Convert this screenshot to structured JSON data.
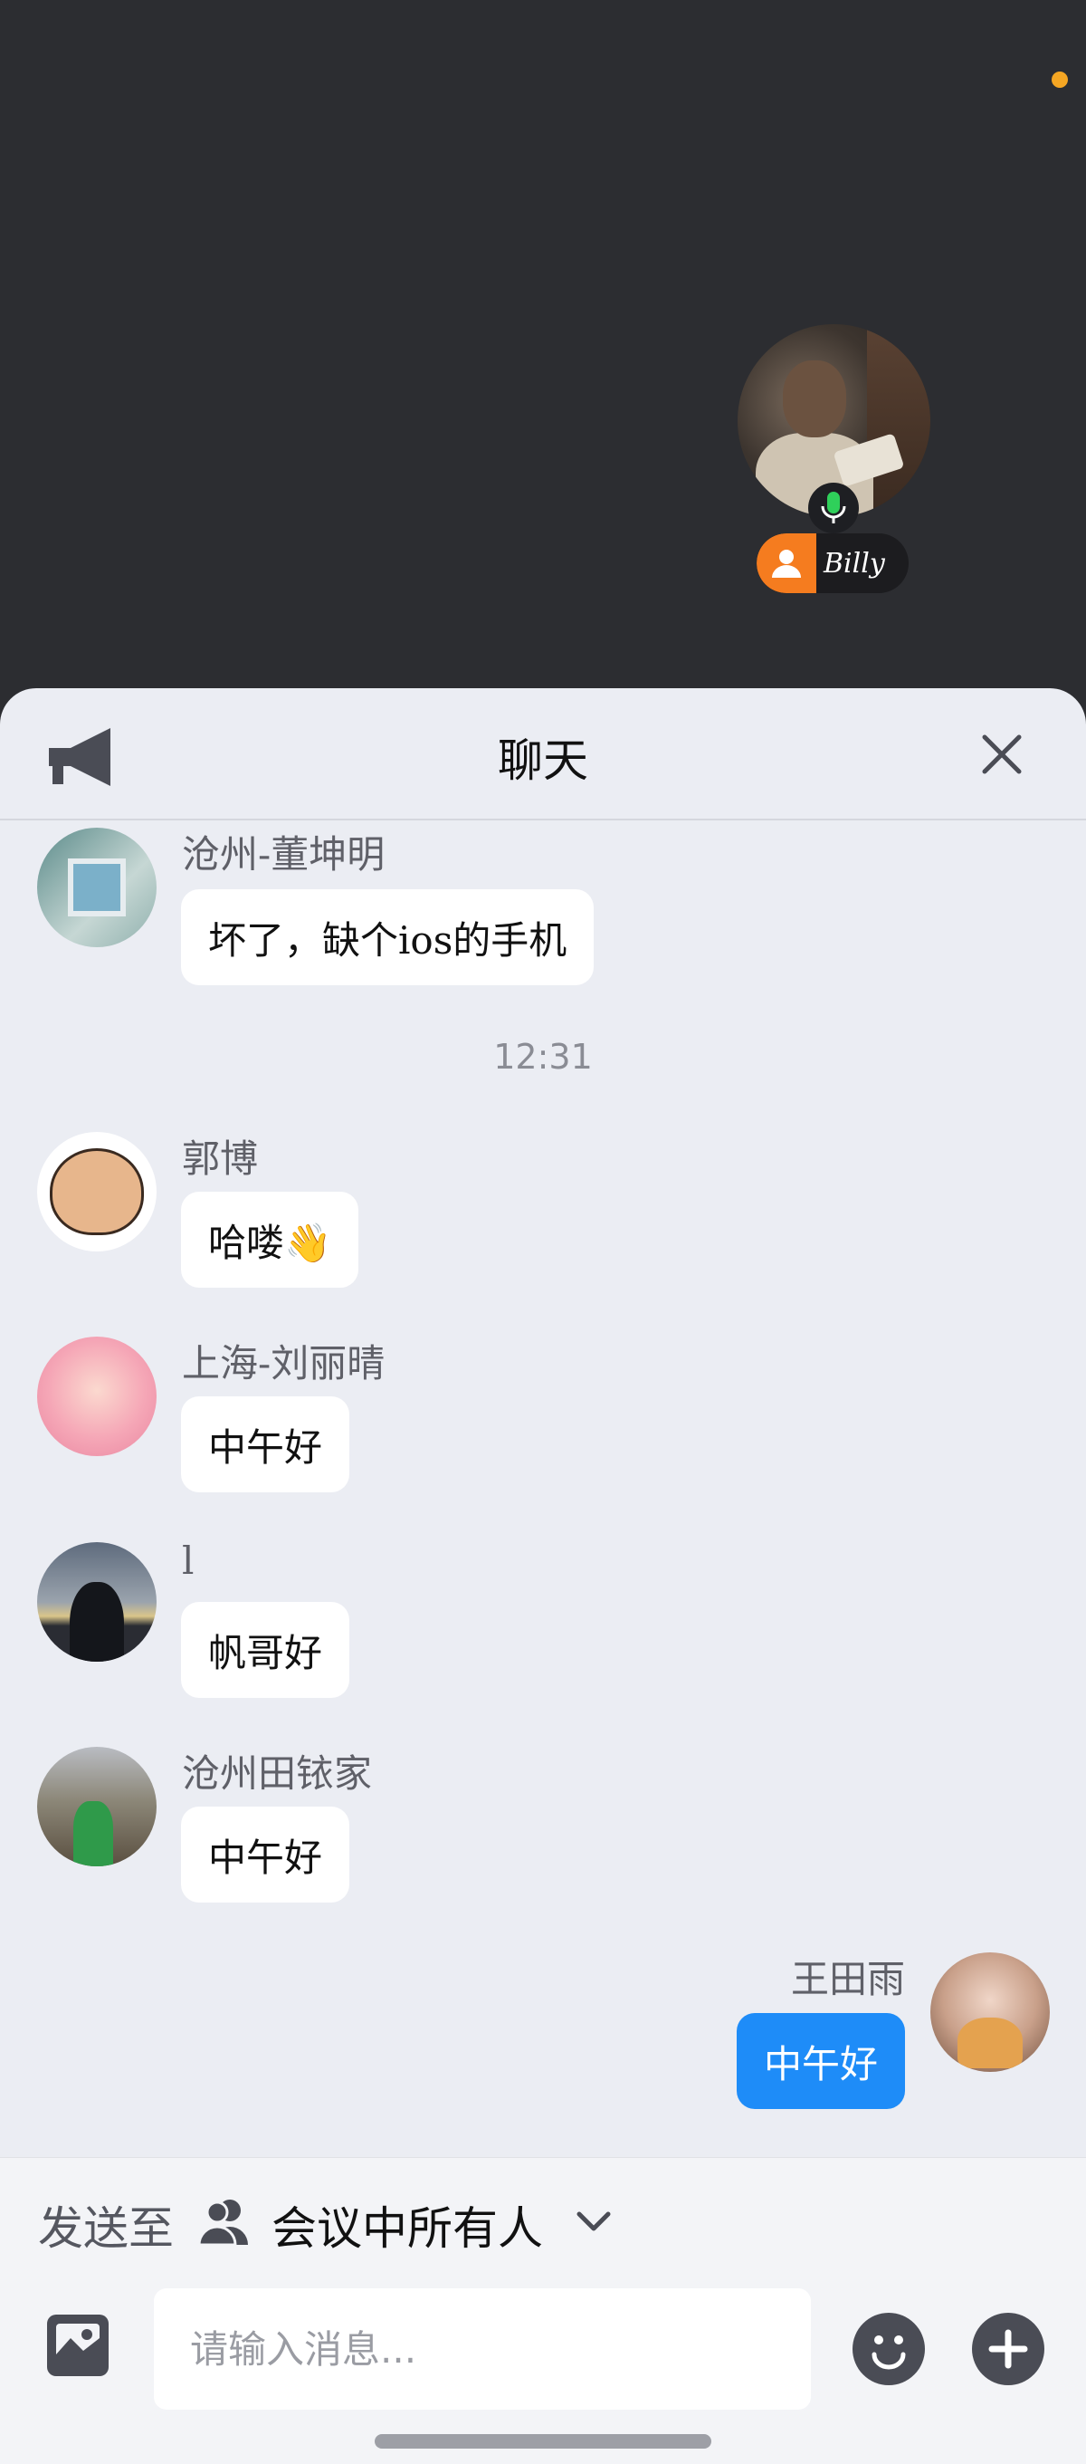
{
  "video": {
    "participant_name": "Billy",
    "mic_state": "active",
    "role_icon": "person-icon"
  },
  "chat": {
    "title": "聊天",
    "announce_icon": "megaphone-icon",
    "close_icon": "close-icon",
    "messages": [
      {
        "sender": "沧州-董坤明",
        "text": "坏了，缺个ios的手机"
      },
      {
        "timestamp": "12:31"
      },
      {
        "sender": "郭博",
        "text": "哈喽👋"
      },
      {
        "sender": "上海-刘丽晴",
        "text": "中午好"
      },
      {
        "sender": "l",
        "text": "帆哥好"
      },
      {
        "sender": "沧州田铱家",
        "text": "中午好"
      },
      {
        "sender": "王田雨",
        "text": "中午好",
        "mine": true
      }
    ]
  },
  "send_to": {
    "label": "发送至",
    "target": "会议中所有人"
  },
  "composer": {
    "placeholder": "请输入消息...",
    "value": ""
  },
  "colors": {
    "accent_blue": "#1e8cf8",
    "role_orange": "#f57c1f",
    "mic_green": "#2fd05a",
    "indicator_orange": "#f5a623"
  }
}
